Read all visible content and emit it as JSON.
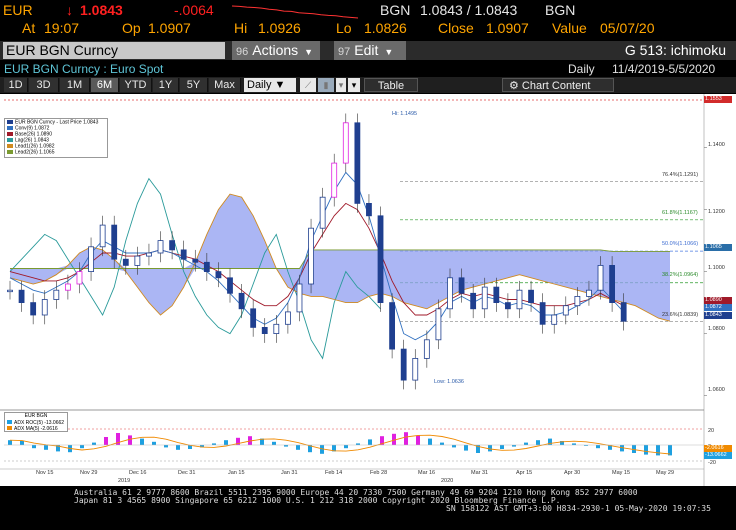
{
  "quote": {
    "ticker": "EUR",
    "arrow": "↓",
    "last": "1.0843",
    "change": "-.0064",
    "sparkline": [
      1.0907,
      1.0905,
      1.0901,
      1.0899,
      1.0896,
      1.089,
      1.0886,
      1.088,
      1.0878,
      1.0871,
      1.0868,
      1.0866,
      1.086,
      1.0857,
      1.0855,
      1.085,
      1.0846,
      1.0843
    ],
    "bid_ccy": "BGN",
    "bid_ask": "1.0843 / 1.0843",
    "ask_ccy": "BGN",
    "at_label": "At",
    "time": "19:07",
    "op_label": "Op",
    "open": "1.0907",
    "hi_label": "Hi",
    "high": "1.0926",
    "lo_label": "Lo",
    "low": "1.0826",
    "close_label": "Close",
    "close": "1.0907",
    "value_label": "Value",
    "value_date": "05/07/20"
  },
  "toolbar": {
    "ticker_field": "EUR BGN Curncy",
    "actions_num": "96",
    "actions_label": "Actions",
    "edit_num": "97",
    "edit_label": "Edit",
    "function": "G 513: ichimoku"
  },
  "subtitle": {
    "security": "EUR BGN Curncy : Euro Spot",
    "frequency": "Daily",
    "range": "11/4/2019-5/5/2020"
  },
  "periods": [
    "1D",
    "3D",
    "1M",
    "6M",
    "YTD",
    "1Y",
    "5Y",
    "Max"
  ],
  "active_period": "6M",
  "frequency_select": "Daily ▼",
  "table_label": "Table",
  "chart_content_label": "Chart Content",
  "legend": [
    {
      "label": "EUR BGN Curncy - Last Price 1.0843",
      "color": "#1f3f8f"
    },
    {
      "label": "Conv(9)  1.0872",
      "color": "#3070c0"
    },
    {
      "label": "Base(26)  1.0890",
      "color": "#a01a2a"
    },
    {
      "label": "Lag(26)  1.0843",
      "color": "#2a9a9a"
    },
    {
      "label": "Lead1(26)  1.0982",
      "color": "#d08a20"
    },
    {
      "label": "Lead2(26)  1.1065",
      "color": "#7a9a30"
    }
  ],
  "chart_data": {
    "type": "line",
    "series": [
      {
        "name": "EUR BGN Curncy - Last Price",
        "values": [
          1.094,
          1.09,
          1.086,
          1.091,
          1.094,
          1.096,
          1.1,
          1.108,
          1.115,
          1.104,
          1.102,
          1.105,
          1.106,
          1.11,
          1.107,
          1.104,
          1.103,
          1.1,
          1.098,
          1.093,
          1.088,
          1.082,
          1.08,
          1.083,
          1.087,
          1.096,
          1.114,
          1.124,
          1.135,
          1.148,
          1.122,
          1.118,
          1.09,
          1.075,
          1.065,
          1.072,
          1.078,
          1.088,
          1.098,
          1.093,
          1.088,
          1.095,
          1.09,
          1.088,
          1.094,
          1.09,
          1.083,
          1.086,
          1.089,
          1.092,
          1.094,
          1.102,
          1.09,
          1.084
        ]
      },
      {
        "name": "Conv(9)",
        "values": [
          1.098,
          1.096,
          1.094,
          1.093,
          1.095,
          1.097,
          1.1,
          1.106,
          1.11,
          1.108,
          1.106,
          1.106,
          1.106,
          1.107,
          1.106,
          1.104,
          1.102,
          1.1,
          1.097,
          1.093,
          1.089,
          1.085,
          1.083,
          1.085,
          1.09,
          1.098,
          1.11,
          1.118,
          1.126,
          1.132,
          1.128,
          1.118,
          1.105,
          1.092,
          1.08,
          1.078,
          1.08,
          1.084,
          1.09,
          1.092,
          1.09,
          1.092,
          1.091,
          1.089,
          1.09,
          1.089,
          1.086,
          1.086,
          1.087,
          1.089,
          1.091,
          1.095,
          1.091,
          1.087
        ]
      },
      {
        "name": "Base(26)",
        "values": [
          1.1,
          1.099,
          1.098,
          1.097,
          1.097,
          1.098,
          1.1,
          1.103,
          1.106,
          1.106,
          1.105,
          1.105,
          1.106,
          1.107,
          1.106,
          1.105,
          1.104,
          1.102,
          1.1,
          1.097,
          1.094,
          1.091,
          1.089,
          1.089,
          1.092,
          1.098,
          1.106,
          1.112,
          1.118,
          1.122,
          1.12,
          1.114,
          1.106,
          1.097,
          1.09,
          1.086,
          1.086,
          1.088,
          1.091,
          1.093,
          1.092,
          1.093,
          1.092,
          1.091,
          1.091,
          1.09,
          1.089,
          1.089,
          1.089,
          1.09,
          1.091,
          1.093,
          1.091,
          1.089
        ]
      },
      {
        "name": "Lag(26)",
        "values": [
          1.1,
          1.104,
          1.108,
          1.112,
          1.11,
          1.104,
          1.098,
          1.092,
          1.086,
          1.095,
          1.11,
          1.122,
          1.13,
          1.125,
          1.112,
          1.1,
          1.092,
          1.086,
          1.082,
          1.08,
          1.086,
          1.096,
          1.106,
          1.112,
          1.1,
          1.09,
          1.078,
          1.072,
          1.09,
          1.1,
          1.095,
          1.092,
          1.088
        ]
      },
      {
        "name": "Lead1(26)",
        "values": [
          1.098,
          1.097,
          1.096,
          1.097,
          1.099,
          1.102,
          1.106,
          1.108,
          1.107,
          1.104,
          1.1,
          1.095,
          1.09,
          1.086,
          1.089,
          1.095,
          1.103,
          1.112,
          1.12,
          1.125,
          1.124,
          1.118,
          1.11,
          1.101,
          1.095,
          1.093,
          1.092,
          1.092,
          1.091,
          1.09,
          1.09,
          1.092,
          1.093,
          1.092,
          1.09,
          1.089,
          1.088,
          1.09,
          1.092,
          1.094,
          1.095,
          1.096,
          1.097,
          1.098,
          1.099,
          1.098,
          1.097,
          1.096,
          1.095,
          1.094,
          1.093,
          1.092,
          1.091,
          1.09,
          1.089,
          1.087,
          1.085,
          1.084
        ]
      },
      {
        "name": "Lead2(26)",
        "values": [
          1.101,
          1.101,
          1.101,
          1.101,
          1.101,
          1.101,
          1.101,
          1.101,
          1.101,
          1.101,
          1.101,
          1.101,
          1.101,
          1.101,
          1.101,
          1.101,
          1.101,
          1.101,
          1.101,
          1.101,
          1.101,
          1.101,
          1.101,
          1.101,
          1.101,
          1.101,
          1.107,
          1.107,
          1.107,
          1.107,
          1.107,
          1.107,
          1.107,
          1.107,
          1.107,
          1.107,
          1.107,
          1.107,
          1.107,
          1.107,
          1.107,
          1.107,
          1.107,
          1.107,
          1.107,
          1.107,
          1.107,
          1.107,
          1.107,
          1.107,
          1.107,
          1.107,
          1.1065,
          1.1065,
          1.1065,
          1.1065,
          1.1065,
          1.1065
        ]
      }
    ],
    "y_ticks": [
      "1.1400",
      "1.1200",
      "1.1000",
      "1.0800",
      "1.0600"
    ],
    "y_range": [
      1.056,
      1.156
    ],
    "x_ticks": [
      "Nov 15",
      "Nov 29",
      "Dec 16",
      "Dec 31",
      "Jan 15",
      "Jan 31",
      "Feb 14",
      "Feb 28",
      "Mar 16",
      "Mar 31",
      "Apr 15",
      "Apr 30",
      "May 15",
      "May 29"
    ],
    "years": [
      "2019",
      "2020"
    ],
    "hi_label": "Hi: 1.1495",
    "low_label": "Low: 1.0636",
    "fib_labels": [
      "76.4%(1.1291)",
      "61.8%(1.1167)",
      "50.0%(1.1066)",
      "38.2%(1.0964)",
      "23.6%(1.0839)"
    ],
    "price_tags": [
      {
        "text": "1.1553",
        "color": "#d22b2b"
      },
      {
        "text": "1.1065",
        "color": "#2a6ea8"
      },
      {
        "text": "1.0890",
        "color": "#a01a2a"
      },
      {
        "text": "1.0872",
        "color": "#3070c0"
      },
      {
        "text": "1.0843",
        "color": "#1f3f8f"
      }
    ],
    "indicator": {
      "title": "EUR BGN",
      "roc_label": "ADX ROC(5)",
      "roc_value": "-13.0662",
      "ma_label": "ADX MA(5)",
      "ma_value": "-2.0616",
      "tags": [
        "-2.0616",
        "-13.0662"
      ],
      "y_ticks": [
        "20",
        "0",
        "-20"
      ]
    }
  },
  "footer": {
    "line1": "Australia 61 2 9777 8600 Brazil 5511 2395 9000 Europe 44 20 7330 7500 Germany 49 69 9204 1210 Hong Kong 852 2977 6000",
    "line2": "Japan 81 3 4565 8900        Singapore 65 6212 1000       U.S. 1 212 318 2000         Copyright 2020 Bloomberg Finance L.P.",
    "line3": "SN 158122 AST  GMT+3:00 H834-2930-1 05-May-2020 19:07:35"
  }
}
